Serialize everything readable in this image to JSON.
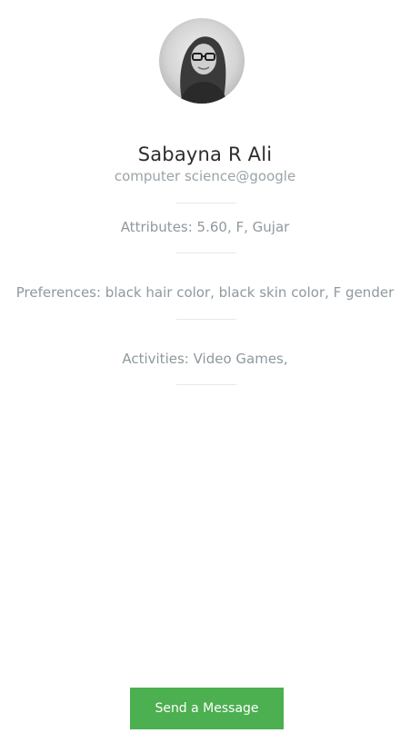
{
  "profile": {
    "name": "Sabayna R Ali",
    "subtitle": "computer science@google"
  },
  "details": {
    "attributes": "Attributes: 5.60, F, Gujar",
    "preferences": "Preferences: black hair color, black skin color, F gender",
    "activities": "Activities: Video Games,"
  },
  "actions": {
    "send_message_label": "Send a Message"
  },
  "colors": {
    "accent": "#4caf50",
    "muted_text": "#8e999e",
    "name_text": "#2d2d2d"
  },
  "icons": {
    "avatar": "profile-photo"
  }
}
